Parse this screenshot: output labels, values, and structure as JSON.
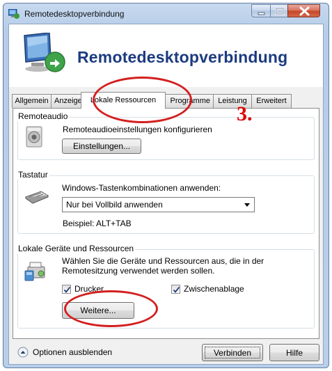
{
  "window": {
    "title": "Remotedesktopverbindung"
  },
  "banner": {
    "title": "Remotedesktopverbindung"
  },
  "tabs": [
    {
      "label": "Allgemein"
    },
    {
      "label": "Anzeige"
    },
    {
      "label": "Lokale Ressourcen"
    },
    {
      "label": "Programme"
    },
    {
      "label": "Leistung"
    },
    {
      "label": "Erweitert"
    }
  ],
  "remoteaudio": {
    "label": "Remoteaudio",
    "description": "Remoteaudioeinstellungen konfigurieren",
    "button": "Einstellungen..."
  },
  "tastatur": {
    "label": "Tastatur",
    "description": "Windows-Tastenkombinationen anwenden:",
    "selected": "Nur bei Vollbild anwenden",
    "example": "Beispiel: ALT+TAB"
  },
  "geraete": {
    "label": "Lokale Geräte und Ressourcen",
    "description_line1": "Wählen Sie die Geräte und Ressourcen aus, die in der",
    "description_line2": "Remotesitzung verwendet werden sollen.",
    "checkbox_printer": "Drucker",
    "printer_checked": true,
    "checkbox_clipboard": "Zwischenablage",
    "clipboard_checked": true,
    "more_button": "Weitere..."
  },
  "footer": {
    "options_toggle": "Optionen ausblenden",
    "connect_button": "Verbinden",
    "help_button": "Hilfe"
  },
  "annotation": {
    "step": "3.",
    "color": "#e00000"
  }
}
